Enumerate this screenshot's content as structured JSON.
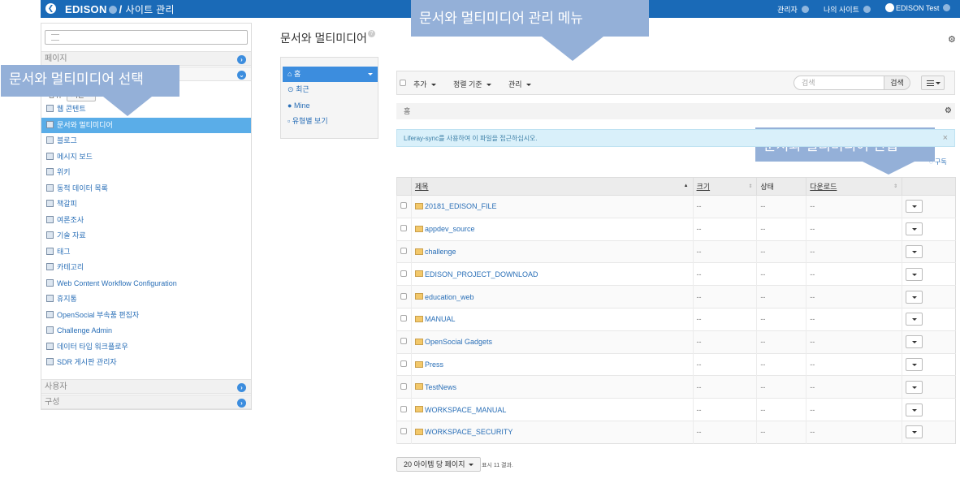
{
  "topbar": {
    "site_name": "EDISON",
    "separator": "/",
    "section": "사이트 관리",
    "admin_menu": "관리자",
    "my_sites": "나의 사이트",
    "user_name": "EDISON Test"
  },
  "sidebar": {
    "sections": {
      "pages": "페이지",
      "users": "사용자",
      "config": "구성"
    },
    "scope_label": "범위",
    "scope_value": "기본",
    "items": [
      {
        "label": "웹 콘텐트",
        "icon": "web-content-icon"
      },
      {
        "label": "문서와 멀티미디어",
        "icon": "documents-icon"
      },
      {
        "label": "블로그",
        "icon": "blog-icon"
      },
      {
        "label": "메시지 보드",
        "icon": "message-board-icon"
      },
      {
        "label": "위키",
        "icon": "wiki-icon"
      },
      {
        "label": "동적 데이터 목록",
        "icon": "dynamic-data-icon"
      },
      {
        "label": "책갈피",
        "icon": "bookmarks-icon"
      },
      {
        "label": "여론조사",
        "icon": "polls-icon"
      },
      {
        "label": "기술 자료",
        "icon": "knowledge-base-icon"
      },
      {
        "label": "태그",
        "icon": "tags-icon"
      },
      {
        "label": "카테고리",
        "icon": "categories-icon"
      },
      {
        "label": "Web Content Workflow Configuration",
        "icon": "workflow-config-icon"
      },
      {
        "label": "휴지통",
        "icon": "trash-icon"
      },
      {
        "label": "OpenSocial 부속품 편집자",
        "icon": "opensocial-icon"
      },
      {
        "label": "Challenge Admin",
        "icon": "challenge-admin-icon"
      },
      {
        "label": "데이터 타입 워크플로우",
        "icon": "data-type-workflow-icon"
      },
      {
        "label": "SDR 게시판 관리자",
        "icon": "sdr-board-icon"
      }
    ]
  },
  "callouts": {
    "left": "문서와 멀티미디어 선택",
    "top": "문서와 멀티미디어 관리 메뉴",
    "right": "문서와 멀티미디어 편집"
  },
  "main": {
    "title": "문서와 멀티미디어",
    "help": "?",
    "nav": [
      {
        "label": "홈",
        "icon": "home-icon"
      },
      {
        "label": "최근",
        "icon": "clock-icon"
      },
      {
        "label": "Mine",
        "icon": "user-icon"
      },
      {
        "label": "유형별 보기",
        "icon": "document-icon"
      }
    ],
    "toolbar": {
      "add": "추가",
      "sort": "정렬 기준",
      "manage": "관리",
      "search_placeholder": "검색",
      "search_button": "검색"
    },
    "breadcrumb": "홈",
    "alert": "Liferay-sync를 사용하여 이 파일을 접근하십시오.",
    "alert_close": "×",
    "subscribe": "구독",
    "table": {
      "headers": [
        "제목",
        "크기",
        "상태",
        "다운로드"
      ],
      "rows": [
        {
          "name": "20181_EDISON_FILE",
          "size": "--",
          "status": "--",
          "downloads": "--"
        },
        {
          "name": "appdev_source",
          "size": "--",
          "status": "--",
          "downloads": "--"
        },
        {
          "name": "challenge",
          "size": "--",
          "status": "--",
          "downloads": "--"
        },
        {
          "name": "EDISON_PROJECT_DOWNLOAD",
          "size": "--",
          "status": "--",
          "downloads": "--"
        },
        {
          "name": "education_web",
          "size": "--",
          "status": "--",
          "downloads": "--"
        },
        {
          "name": "MANUAL",
          "size": "--",
          "status": "--",
          "downloads": "--"
        },
        {
          "name": "OpenSocial Gadgets",
          "size": "--",
          "status": "--",
          "downloads": "--"
        },
        {
          "name": "Press",
          "size": "--",
          "status": "--",
          "downloads": "--"
        },
        {
          "name": "TestNews",
          "size": "--",
          "status": "--",
          "downloads": "--"
        },
        {
          "name": "WORKSPACE_MANUAL",
          "size": "--",
          "status": "--",
          "downloads": "--"
        },
        {
          "name": "WORKSPACE_SECURITY",
          "size": "--",
          "status": "--",
          "downloads": "--"
        }
      ]
    },
    "pager": "20 아이템 당 페이지",
    "results": "표시 11 결과."
  },
  "colors": {
    "topbar": "#1a6ab7",
    "active": "#5aade8",
    "callout": "#94b0d8",
    "link": "#2a6fb7"
  }
}
